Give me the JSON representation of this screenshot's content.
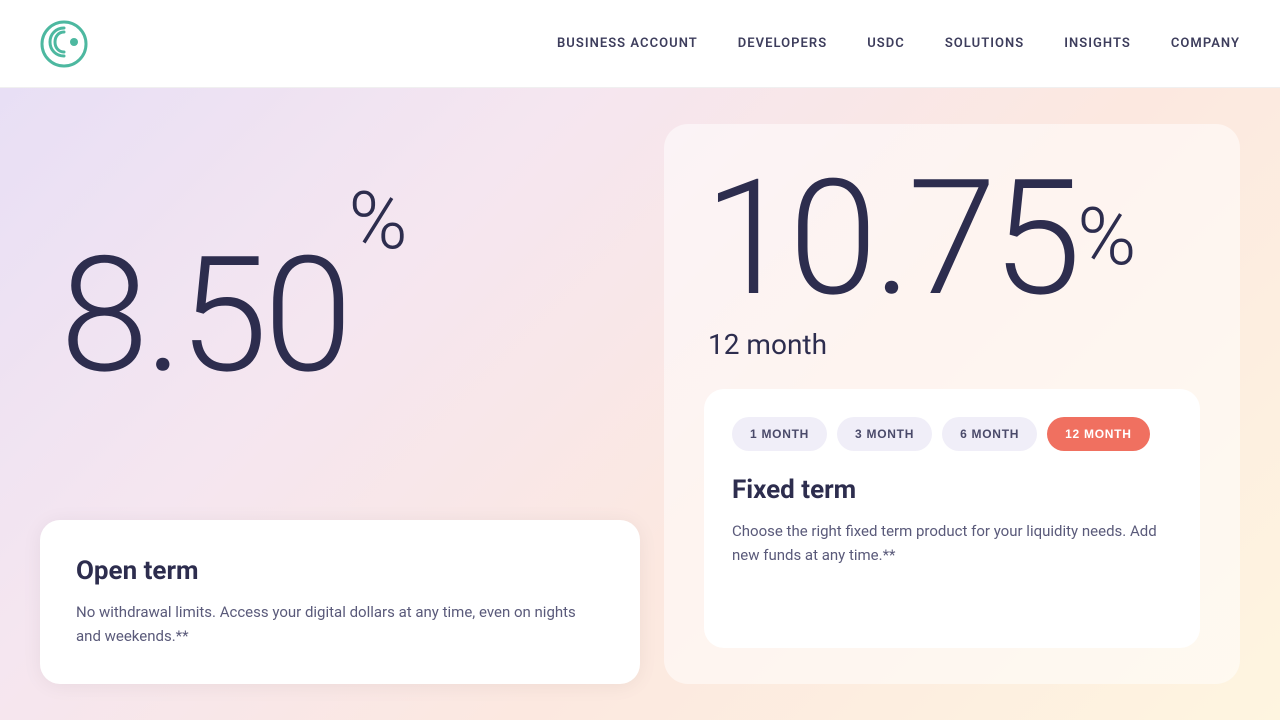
{
  "header": {
    "logo_alt": "Circle logo",
    "nav": {
      "items": [
        {
          "label": "BUSINESS ACCOUNT",
          "id": "business-account"
        },
        {
          "label": "DEVELOPERS",
          "id": "developers"
        },
        {
          "label": "USDC",
          "id": "usdc"
        },
        {
          "label": "SOLUTIONS",
          "id": "solutions"
        },
        {
          "label": "INSIGHTS",
          "id": "insights"
        },
        {
          "label": "COMPANY",
          "id": "company"
        }
      ]
    }
  },
  "main": {
    "left": {
      "rate_integer": "8",
      "rate_decimal": ".50",
      "rate_percent": "%",
      "card": {
        "title": "Open term",
        "description": "No withdrawal limits. Access your digital dollars at any time, even on nights and weekends.**"
      }
    },
    "right": {
      "rate_integer": "10",
      "rate_decimal": ".75",
      "rate_percent": "%",
      "period": "12 month",
      "term_buttons": [
        {
          "label": "1 MONTH",
          "active": false
        },
        {
          "label": "3 MONTH",
          "active": false
        },
        {
          "label": "6 MONTH",
          "active": false
        },
        {
          "label": "12 MONTH",
          "active": true
        }
      ],
      "card": {
        "title": "Fixed term",
        "description": "Choose the right fixed term product for your liquidity needs. Add new funds at any time.**"
      }
    }
  }
}
